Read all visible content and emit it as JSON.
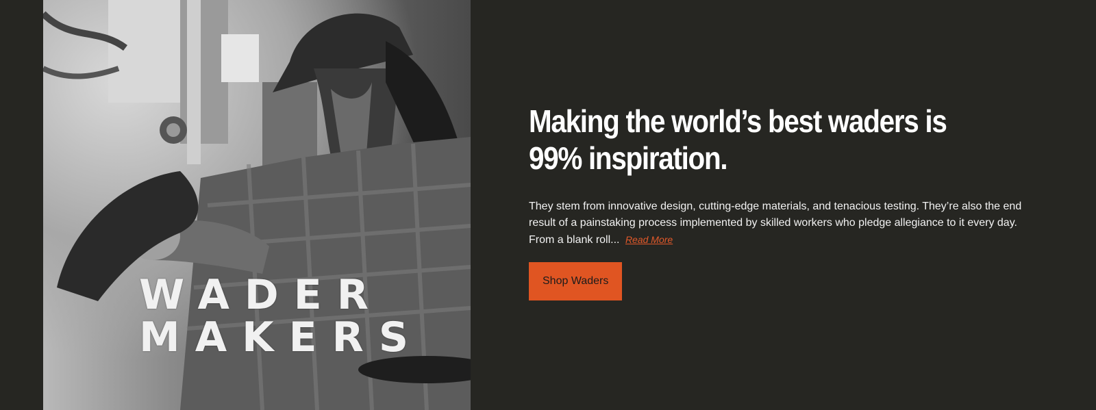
{
  "hero": {
    "image_overlay_line1": "WADER",
    "image_overlay_line2": "MAKERS"
  },
  "content": {
    "headline": "Making the world’s best waders is 99% inspiration.",
    "body": "They stem from innovative design, cutting-edge materials, and tenacious testing. They’re also the end result of a painstaking process implemented by skilled workers who pledge allegiance to it every day. From a blank roll...",
    "read_more_label": "Read More",
    "shop_button_label": "Shop Waders"
  },
  "colors": {
    "background": "#262622",
    "accent": "#e05522",
    "headline": "#ffffff"
  }
}
